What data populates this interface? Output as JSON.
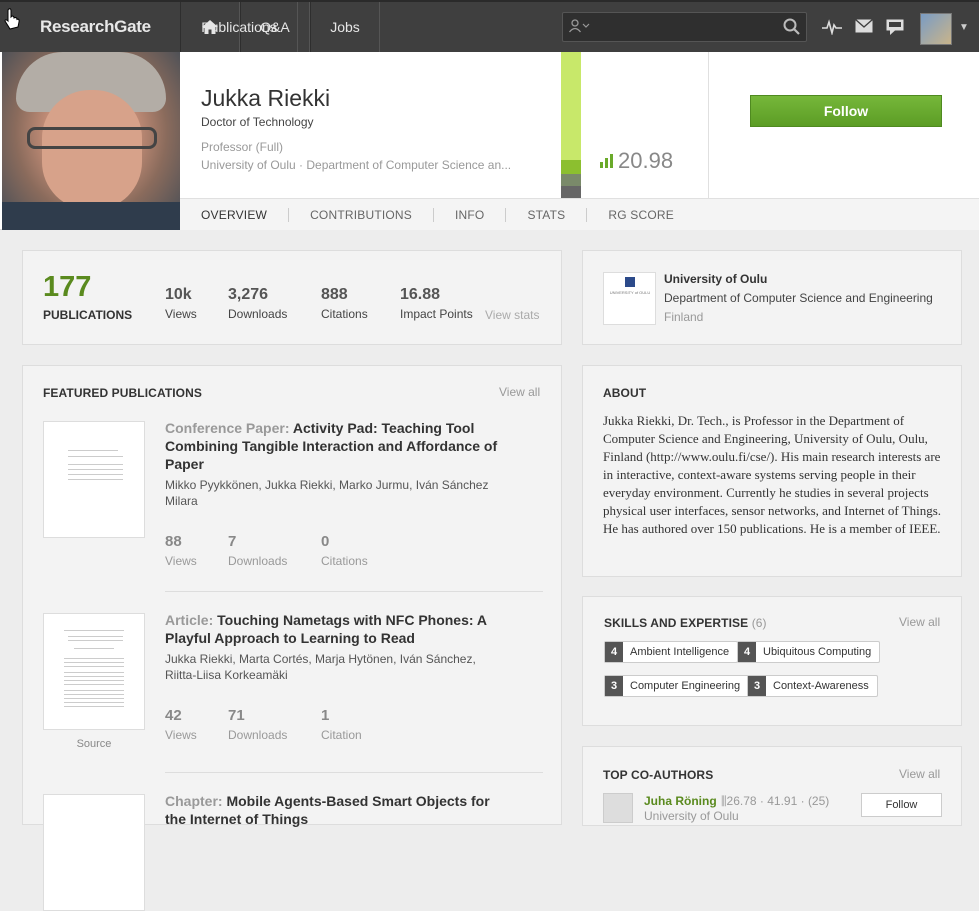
{
  "topbar": {
    "logo": "ResearchGate",
    "nav": [
      "Q&A",
      "Publications",
      "Jobs"
    ],
    "search_placeholder": ""
  },
  "profile": {
    "name": "Jukka Riekki",
    "degree": "Doctor of Technology",
    "position": "Professor (Full)",
    "affiliation": "University of Oulu · Department of Computer Science an...",
    "rg_score": "20.98",
    "follow_label": "Follow",
    "tabs": [
      "OVERVIEW",
      "CONTRIBUTIONS",
      "INFO",
      "STATS",
      "RG SCORE"
    ]
  },
  "stats": {
    "publications_count": "177",
    "publications_label": "PUBLICATIONS",
    "items": [
      {
        "value": "10k",
        "label": "Views"
      },
      {
        "value": "3,276",
        "label": "Downloads"
      },
      {
        "value": "888",
        "label": "Citations"
      },
      {
        "value": "16.88",
        "label": "Impact Points"
      }
    ],
    "view_stats": "View stats"
  },
  "institution": {
    "name": "University of Oulu",
    "department": "Department of Computer Science and Engineering",
    "country": "Finland",
    "logo_text": "UNIVERSITY of OULU"
  },
  "featured": {
    "title": "FEATURED PUBLICATIONS",
    "view_all": "View all",
    "items": [
      {
        "type": "Conference Paper:",
        "title": "Activity Pad: Teaching Tool Combining Tangible Interaction and Affordance of Paper",
        "authors": "Mikko Pyykkönen, Jukka Riekki, Marko Jurmu, Iván Sánchez Milara",
        "views": "88",
        "views_label": "Views",
        "downloads": "7",
        "downloads_label": "Downloads",
        "citations": "0",
        "citations_label": "Citations"
      },
      {
        "type": "Article:",
        "title": "Touching Nametags with NFC Phones: A Playful Approach to Learning to Read",
        "authors": "Jukka Riekki, Marta Cortés, Marja Hytönen, Iván Sánchez, Riitta-Liisa Korkeamäki",
        "views": "42",
        "views_label": "Views",
        "downloads": "71",
        "downloads_label": "Downloads",
        "citations": "1",
        "citations_label": "Citation",
        "source": "Source"
      },
      {
        "type": "Chapter:",
        "title": "Mobile Agents-Based Smart Objects for the Internet of Things"
      }
    ]
  },
  "about": {
    "title": "ABOUT",
    "text": "Jukka Riekki, Dr. Tech., is Professor in the Department of Computer Science and Engineering, University of Oulu, Oulu, Finland (http://www.oulu.fi/cse/). His main research interests are in interactive, context-aware systems serving people in their everyday environment. Currently he studies in several projects physical user interfaces, sensor networks, and Internet of Things. He has authored over 150 publications. He is a member of IEEE."
  },
  "skills": {
    "title": "SKILLS AND EXPERTISE",
    "count": "(6)",
    "view_all": "View all",
    "items": [
      {
        "n": "4",
        "label": "Ambient Intelligence"
      },
      {
        "n": "4",
        "label": "Ubiquitous Computing"
      },
      {
        "n": "3",
        "label": "Computer Engineering"
      },
      {
        "n": "3",
        "label": "Context-Awareness"
      }
    ]
  },
  "coauthors": {
    "title": "TOP CO-AUTHORS",
    "view_all": "View all",
    "items": [
      {
        "name": "Juha Röning",
        "score": "26.78",
        "impact": "41.91",
        "count": "(25)",
        "institution": "University of Oulu",
        "follow": "Follow"
      }
    ]
  },
  "colors": {
    "accent_green": "#5c9d25",
    "topbar": "#3f3f3f",
    "score_bar": "#c8e86a"
  },
  "icons": [
    "home-icon",
    "person-icon",
    "search-icon",
    "activity-icon",
    "mail-icon",
    "chat-icon",
    "chevron-down-icon",
    "score-bars-icon",
    "cursor-icon"
  ]
}
